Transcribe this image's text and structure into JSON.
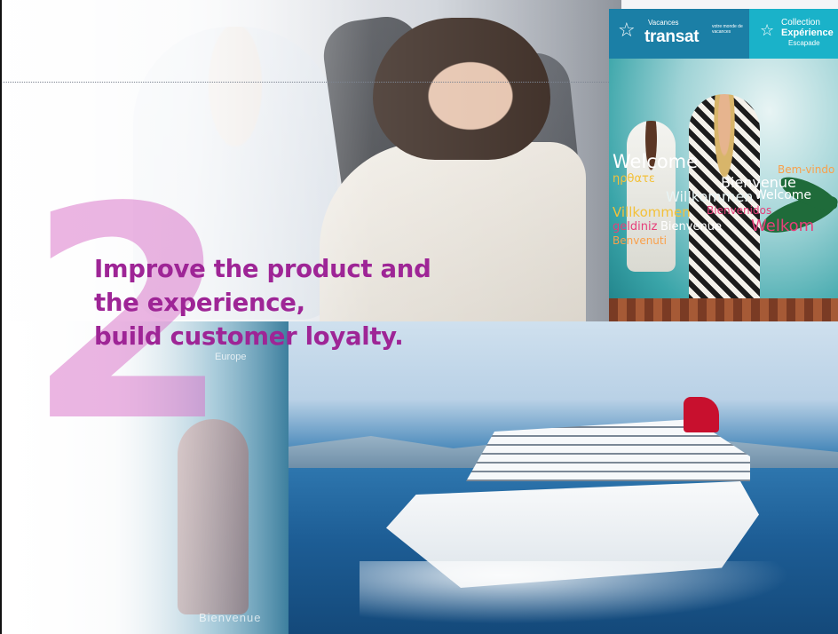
{
  "slide": {
    "number": "2",
    "headline": [
      "Improve the product and",
      "the experience,",
      "build customer loyalty."
    ],
    "accent_color": "#9e2596",
    "number_color": "#d96fc8"
  },
  "brochure_top_right": {
    "brand_small": "Vacances",
    "brand_large": "transat",
    "brand_tagline": "votre monde de vacances",
    "collection_line1": "Collection",
    "collection_line2": "Expérience",
    "collection_line3": "Escapade",
    "icons": [
      "star-icon",
      "star-icon"
    ],
    "welcome_words": [
      "Welcome",
      "ηρθατε",
      "Bem-vindo",
      "Bienvenue",
      "Willkommen",
      "Welcome",
      "Villkommen",
      "Bienvenidos",
      "geldiniz",
      "Bienvenue",
      "Welkom",
      "Benvenuti"
    ]
  },
  "brochure_bottom_left": {
    "label_top": "Europe",
    "label_bottom": "Bienvenue"
  }
}
